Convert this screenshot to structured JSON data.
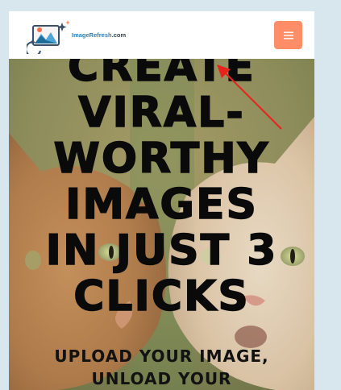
{
  "header": {
    "logo": {
      "text": "ImageRefresh",
      "suffix": ".com"
    }
  },
  "hero": {
    "headline_lines": [
      "CREATE",
      "VIRAL-",
      "WORTHY",
      "IMAGES",
      "IN JUST 3",
      "CLICKS"
    ],
    "subheadline_lines": [
      "UPLOAD YOUR IMAGE,",
      "UNLOAD YOUR"
    ]
  },
  "colors": {
    "page_background": "#d8e6ee",
    "header_background": "#ffffff",
    "menu_button": "#ff8d67",
    "logo_text": "#2f7fb6",
    "annotation_arrow": "#e8231c"
  },
  "icons": {
    "logo": "image-refresh-logo-icon",
    "menu": "hamburger-menu-icon"
  }
}
